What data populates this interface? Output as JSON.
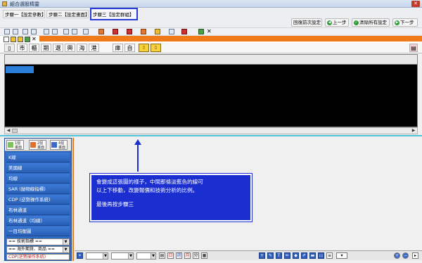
{
  "window": {
    "title": "組合選股精靈"
  },
  "tabs": [
    {
      "label": "步驟一【設定參數】"
    },
    {
      "label": "步驟二【設定畫面】"
    },
    {
      "label": "步驟三【設定群組】"
    }
  ],
  "nav_buttons": {
    "restore": "回復前次設定",
    "prev": "上一步",
    "clear_all": "清除所有設定",
    "next": "下一步"
  },
  "chart_toolbar": [
    "市",
    "櫃",
    "期",
    "選",
    "興",
    "海",
    "港",
    "庫",
    "自"
  ],
  "sidebar": {
    "icon_buttons": [
      "1個畫面",
      "2個畫面",
      "4個畫面"
    ],
    "items": [
      "K線",
      "美國線",
      "均線",
      "SAR (拋物線指標)",
      "CDP (逆勢操作系統)",
      "布林通道",
      "布林通道（均線）",
      "一目均衡圖"
    ],
    "selects": [
      "== 技術指標 ==",
      "== 海外期貨、商品 ==",
      "CDP(逆勢操作系統)"
    ]
  },
  "annotation": {
    "line1": "會變成這張圖的樣子，中間那條淡藍色的線可",
    "line2": "以上下移動，改變報價和技術分析的比例。",
    "line3": "最後再按步驟三"
  },
  "colors": {
    "accent_orange": "#f07a1a",
    "highlight_border": "#2a3bd6",
    "annotation_bg": "#1b2fd0",
    "splitter": "#4fc4dc",
    "sidebar_blue": "#2f69c6"
  }
}
